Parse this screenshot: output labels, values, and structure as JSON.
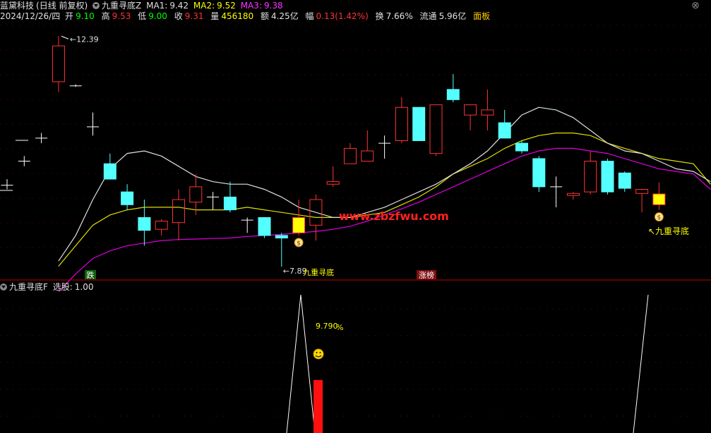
{
  "header": {
    "stock_name": "蓝黛科技",
    "period": "(日线 前复权)",
    "indicator_name": "九重寻底Z",
    "ma1_label": "MA1:",
    "ma1_value": "9.42",
    "ma2_label": "MA2:",
    "ma2_value": "9.52",
    "ma3_label": "MA3:",
    "ma3_value": "9.38",
    "date": "2024/12/26/四",
    "open_label": "开",
    "open_value": "9.10",
    "high_label": "高",
    "high_value": "9.53",
    "low_label": "低",
    "low_value": "9.00",
    "close_label": "收",
    "close_value": "9.31",
    "volume_label": "量",
    "volume_value": "456180",
    "amount_label": "额",
    "amount_value": "4.25亿",
    "change_label": "幅",
    "change_value": "0.13(1.42%)",
    "turnover_label": "换",
    "turnover_value": "7.66%",
    "float_label": "流通",
    "float_value": "5.96亿",
    "panel_label": "面板"
  },
  "sub_header": {
    "indicator_name": "九重寻底F",
    "select_label": "选股:",
    "select_value": "1.00"
  },
  "colors": {
    "up": "#ff3333",
    "down": "#54ffff",
    "signal": "#ffff00",
    "ma1": "#e0e0e0",
    "ma2": "#e0e000",
    "ma3": "#e000e0"
  },
  "chart_data": [
    {
      "type": "candlestick",
      "title": "",
      "y_range": [
        7.7,
        12.6
      ],
      "candles": [
        {
          "o": 9.48,
          "h": 9.6,
          "l": 9.4,
          "c": 9.48
        },
        {
          "o": 9.95,
          "h": 10.05,
          "l": 9.85,
          "c": 9.95
        },
        {
          "o": 10.4,
          "h": 10.5,
          "l": 10.3,
          "c": 10.4
        },
        {
          "o": 11.5,
          "h": 12.39,
          "l": 11.3,
          "c": 12.2
        },
        {
          "o": 11.42,
          "h": 11.45,
          "l": 11.4,
          "c": 11.42
        },
        {
          "o": 10.62,
          "h": 10.9,
          "l": 10.45,
          "c": 10.62
        },
        {
          "o": 9.9,
          "h": 10.1,
          "l": 9.6,
          "c": 9.6
        },
        {
          "o": 9.35,
          "h": 9.5,
          "l": 9.0,
          "c": 9.1
        },
        {
          "o": 8.85,
          "h": 9.2,
          "l": 8.3,
          "c": 8.6
        },
        {
          "o": 8.62,
          "h": 8.82,
          "l": 8.5,
          "c": 8.78
        },
        {
          "o": 8.75,
          "h": 9.4,
          "l": 8.4,
          "c": 9.2
        },
        {
          "o": 9.15,
          "h": 9.7,
          "l": 8.9,
          "c": 9.45
        },
        {
          "o": 9.25,
          "h": 9.35,
          "l": 9.0,
          "c": 9.25
        },
        {
          "o": 9.25,
          "h": 9.55,
          "l": 8.95,
          "c": 9.0
        },
        {
          "o": 8.8,
          "h": 8.85,
          "l": 8.55,
          "c": 8.8
        },
        {
          "o": 8.85,
          "h": 8.85,
          "l": 8.45,
          "c": 8.5
        },
        {
          "o": 8.5,
          "h": 8.55,
          "l": 7.89,
          "c": 8.45
        },
        {
          "o": 8.55,
          "h": 9.2,
          "l": 8.5,
          "c": 8.85
        },
        {
          "o": 8.7,
          "h": 9.3,
          "l": 8.4,
          "c": 9.2
        },
        {
          "o": 9.5,
          "h": 9.85,
          "l": 9.45,
          "c": 9.55
        },
        {
          "o": 9.9,
          "h": 10.3,
          "l": 9.9,
          "c": 10.2
        },
        {
          "o": 9.95,
          "h": 10.55,
          "l": 9.95,
          "c": 10.15
        },
        {
          "o": 10.3,
          "h": 10.45,
          "l": 10.0,
          "c": 10.3
        },
        {
          "o": 10.35,
          "h": 11.2,
          "l": 10.3,
          "c": 11.0
        },
        {
          "o": 11.0,
          "h": 11.0,
          "l": 10.35,
          "c": 10.35
        },
        {
          "o": 10.1,
          "h": 11.05,
          "l": 10.05,
          "c": 11.05
        },
        {
          "o": 11.35,
          "h": 11.65,
          "l": 11.1,
          "c": 11.15
        },
        {
          "o": 10.85,
          "h": 11.05,
          "l": 10.55,
          "c": 11.05
        },
        {
          "o": 10.85,
          "h": 11.35,
          "l": 10.55,
          "c": 10.95
        },
        {
          "o": 10.7,
          "h": 10.95,
          "l": 10.4,
          "c": 10.4
        },
        {
          "o": 10.3,
          "h": 10.35,
          "l": 10.1,
          "c": 10.15
        },
        {
          "o": 10.0,
          "h": 10.05,
          "l": 9.35,
          "c": 9.45
        },
        {
          "o": 9.45,
          "h": 9.65,
          "l": 9.05,
          "c": 9.45
        },
        {
          "o": 9.28,
          "h": 9.35,
          "l": 9.2,
          "c": 9.32
        },
        {
          "o": 9.35,
          "h": 10.15,
          "l": 9.3,
          "c": 9.95
        },
        {
          "o": 9.95,
          "h": 10.0,
          "l": 9.3,
          "c": 9.35
        },
        {
          "o": 9.72,
          "h": 9.75,
          "l": 9.35,
          "c": 9.42
        },
        {
          "o": 9.32,
          "h": 9.38,
          "l": 8.95,
          "c": 9.4
        },
        {
          "o": 9.1,
          "h": 9.53,
          "l": 9.0,
          "c": 9.31
        }
      ],
      "ma1": [
        8.0,
        8.5,
        9.2,
        9.8,
        10.1,
        10.15,
        10.05,
        9.85,
        9.65,
        9.55,
        9.5,
        9.5,
        9.4,
        9.25,
        9.05,
        8.95,
        8.85,
        8.85,
        8.95,
        9.05,
        9.2,
        9.35,
        9.5,
        9.7,
        9.9,
        10.15,
        10.5,
        10.85,
        11.0,
        10.95,
        10.8,
        10.55,
        10.3,
        10.15,
        10.1,
        9.95,
        9.8,
        9.75,
        9.55
      ],
      "ma2": [
        7.9,
        8.3,
        8.7,
        8.9,
        9.0,
        9.05,
        9.05,
        9.05,
        9.0,
        9.0,
        9.0,
        9.05,
        9.0,
        8.95,
        8.9,
        8.85,
        8.85,
        8.85,
        8.9,
        8.95,
        9.1,
        9.25,
        9.45,
        9.7,
        9.85,
        10.0,
        10.2,
        10.35,
        10.45,
        10.5,
        10.5,
        10.45,
        10.3,
        10.2,
        10.1,
        10.0,
        9.95,
        9.9,
        9.5
      ],
      "ma3": [
        7.4,
        7.75,
        8.05,
        8.2,
        8.3,
        8.35,
        8.4,
        8.42,
        8.43,
        8.44,
        8.45,
        8.48,
        8.5,
        8.52,
        8.55,
        8.58,
        8.62,
        8.68,
        8.78,
        8.9,
        9.02,
        9.15,
        9.3,
        9.45,
        9.6,
        9.75,
        9.9,
        10.05,
        10.15,
        10.2,
        10.2,
        10.15,
        10.1,
        10.0,
        9.9,
        9.8,
        9.75,
        9.7,
        9.4
      ],
      "annotations": {
        "high_label": "12.39",
        "low_label": "7.89",
        "signal_label": "九重寻底",
        "signal_label_mid": "九重寻底",
        "fall_label": "跌",
        "limit_up_label": "涨榜",
        "watermark": "www.zbzfwu.com"
      }
    },
    {
      "type": "line+bar",
      "title": "九重寻底F",
      "line_values": [
        0,
        1,
        0,
        1
      ],
      "bar_value": 9.79,
      "bar_label": "9.790",
      "bar_unit": "%"
    }
  ]
}
